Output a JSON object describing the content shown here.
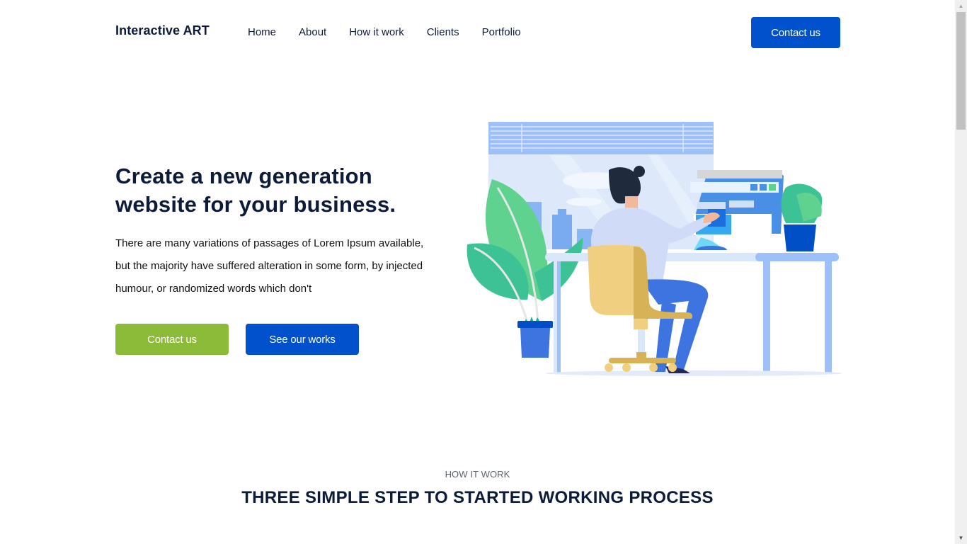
{
  "header": {
    "logo": "Interactive ART",
    "nav": [
      "Home",
      "About",
      "How it work",
      "Clients",
      "Portfolio"
    ],
    "cta": "Contact us"
  },
  "hero": {
    "title": "Create a new generation website for your business.",
    "text": "There are many variations of passages of Lorem Ipsum available, but the majority have suffered alteration in some form, by injected humour, or randomized words which don't",
    "primary_button": "Contact us",
    "secondary_button": "See our works",
    "illustration": "person-working-at-desk-illustration"
  },
  "section": {
    "eyebrow": "HOW IT WORK",
    "title": "THREE SIMPLE STEP TO STARTED WORKING PROCESS"
  },
  "colors": {
    "brand_blue": "#0051cb",
    "accent_green": "#8bbb38",
    "text_dark": "#0c1b3a"
  }
}
